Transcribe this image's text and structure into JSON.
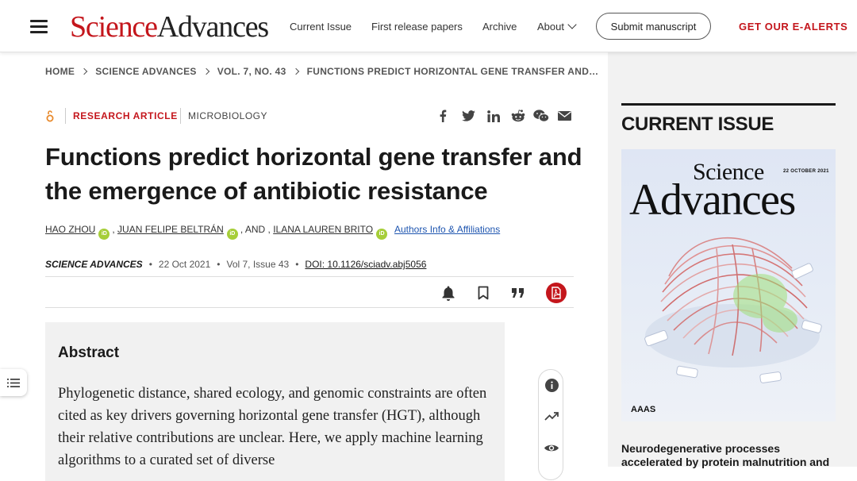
{
  "header": {
    "logo_science": "Science",
    "logo_advances": "Advances",
    "nav": [
      "Current Issue",
      "First release papers",
      "Archive"
    ],
    "about": "About",
    "submit": "Submit manuscript",
    "ealerts": "GET OUR E-ALERTS"
  },
  "breadcrumb": [
    "HOME",
    "SCIENCE ADVANCES",
    "VOL. 7, NO. 43",
    "FUNCTIONS PREDICT HORIZONTAL GENE TRANSFER AND…"
  ],
  "article": {
    "type": "RESEARCH ARTICLE",
    "subject": "MICROBIOLOGY",
    "title": "Functions predict horizontal gene transfer and the emergence of antibiotic resistance",
    "authors": [
      "HAO ZHOU",
      "JUAN FELIPE BELTRÁN",
      "ILANA LAUREN BRITO"
    ],
    "and_sep": ", AND ,",
    "comma": ",",
    "affiliations_link": "Authors Info & Affiliations",
    "journal": "SCIENCE ADVANCES",
    "date": "22 Oct 2021",
    "volume": "Vol 7, Issue 43",
    "doi": "DOI: 10.1126/sciadv.abj5056"
  },
  "share_icons": [
    "facebook-icon",
    "twitter-icon",
    "linkedin-icon",
    "reddit-icon",
    "wechat-icon",
    "email-icon"
  ],
  "abstract": {
    "heading": "Abstract",
    "text": "Phylogenetic distance, shared ecology, and genomic constraints are often cited as key drivers governing horizontal gene transfer (HGT), although their relative contributions are unclear. Here, we apply machine learning algorithms to a curated set of diverse"
  },
  "rail": {
    "title": "CURRENT ISSUE",
    "cover_science": "Science",
    "cover_advances": "Advances",
    "cover_date": "22 OCTOBER 2021",
    "cover_aaas": "AAAS",
    "headline": "Neurodegenerative processes accelerated by protein malnutrition and"
  },
  "colors": {
    "brand_red": "#c4161c",
    "link_blue": "#1f56b0",
    "orcid_green": "#a6ce39"
  }
}
